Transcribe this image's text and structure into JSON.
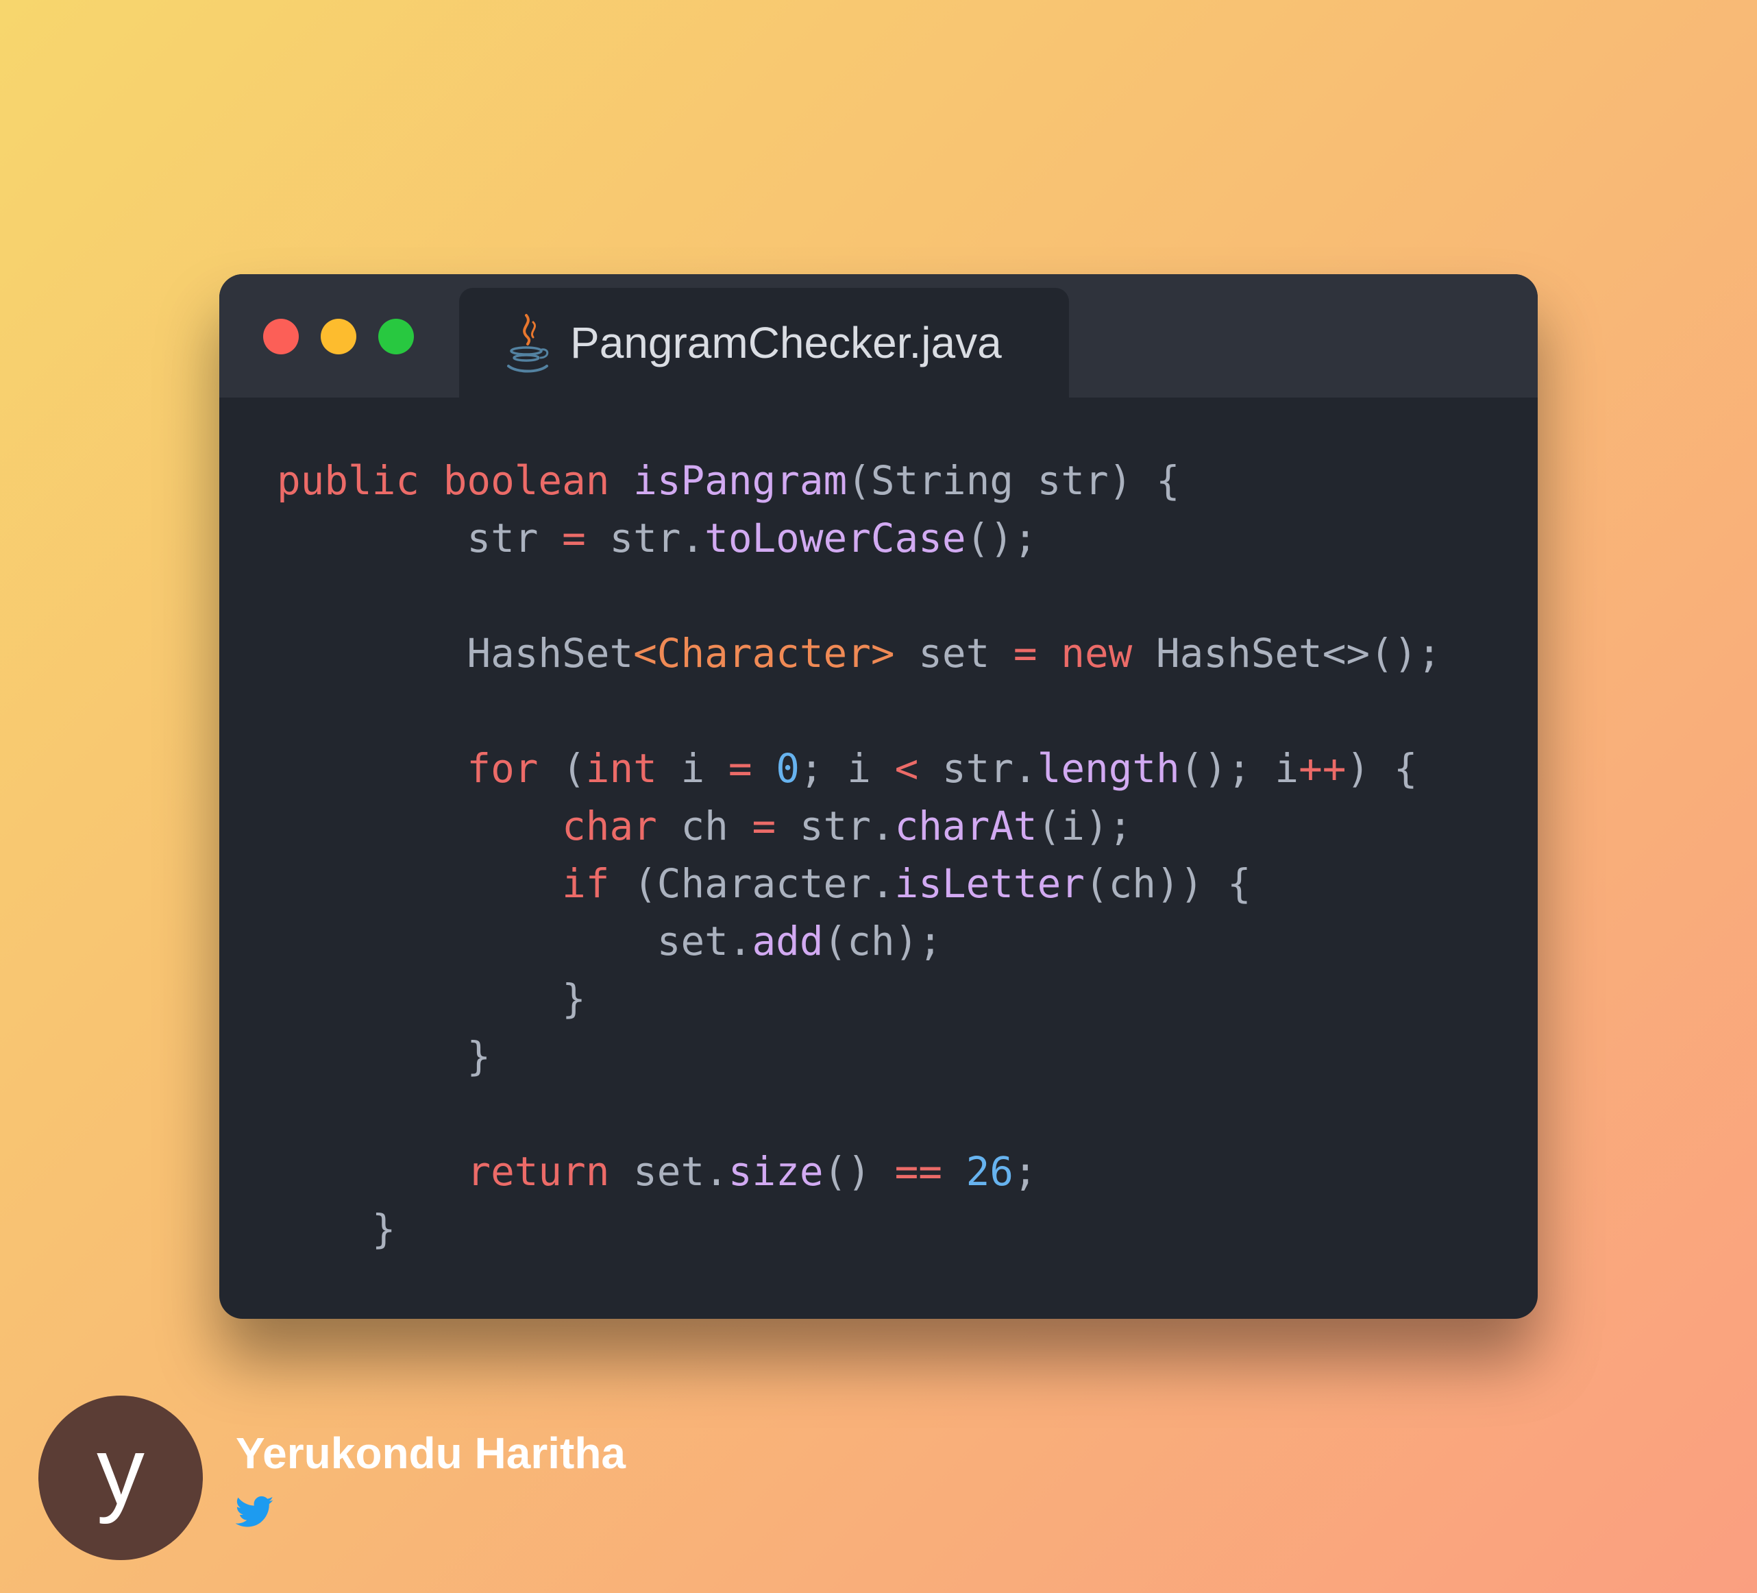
{
  "window": {
    "tab_label": "PangramChecker.java",
    "tab_icon": "java-icon"
  },
  "code_lines": [
    "public boolean isPangram(String str) {",
    "        str = str.toLowerCase();",
    "",
    "        HashSet<Character> set = new HashSet<>();",
    "",
    "        for (int i = 0; i < str.length(); i++) {",
    "            char ch = str.charAt(i);",
    "            if (Character.isLetter(ch)) {",
    "                set.add(ch);",
    "            }",
    "        }",
    "",
    "        return set.size() == 26;",
    "    }"
  ],
  "author": {
    "avatar_letter": "y",
    "name": "Yerukondu Haritha",
    "social_icon": "twitter-icon"
  },
  "colors": {
    "keyword": "#ec6b68",
    "method": "#d2aaf2",
    "number": "#67b3ef",
    "type_param": "#f08a55",
    "default_text": "#abb2bf",
    "editor_bg": "#22262e",
    "titlebar_bg": "#2f333c",
    "close": "#fc5f57",
    "minimize": "#fdbc2e",
    "maximize": "#28c840",
    "avatar_bg": "#5b3d35",
    "twitter": "#1d9bf0"
  }
}
